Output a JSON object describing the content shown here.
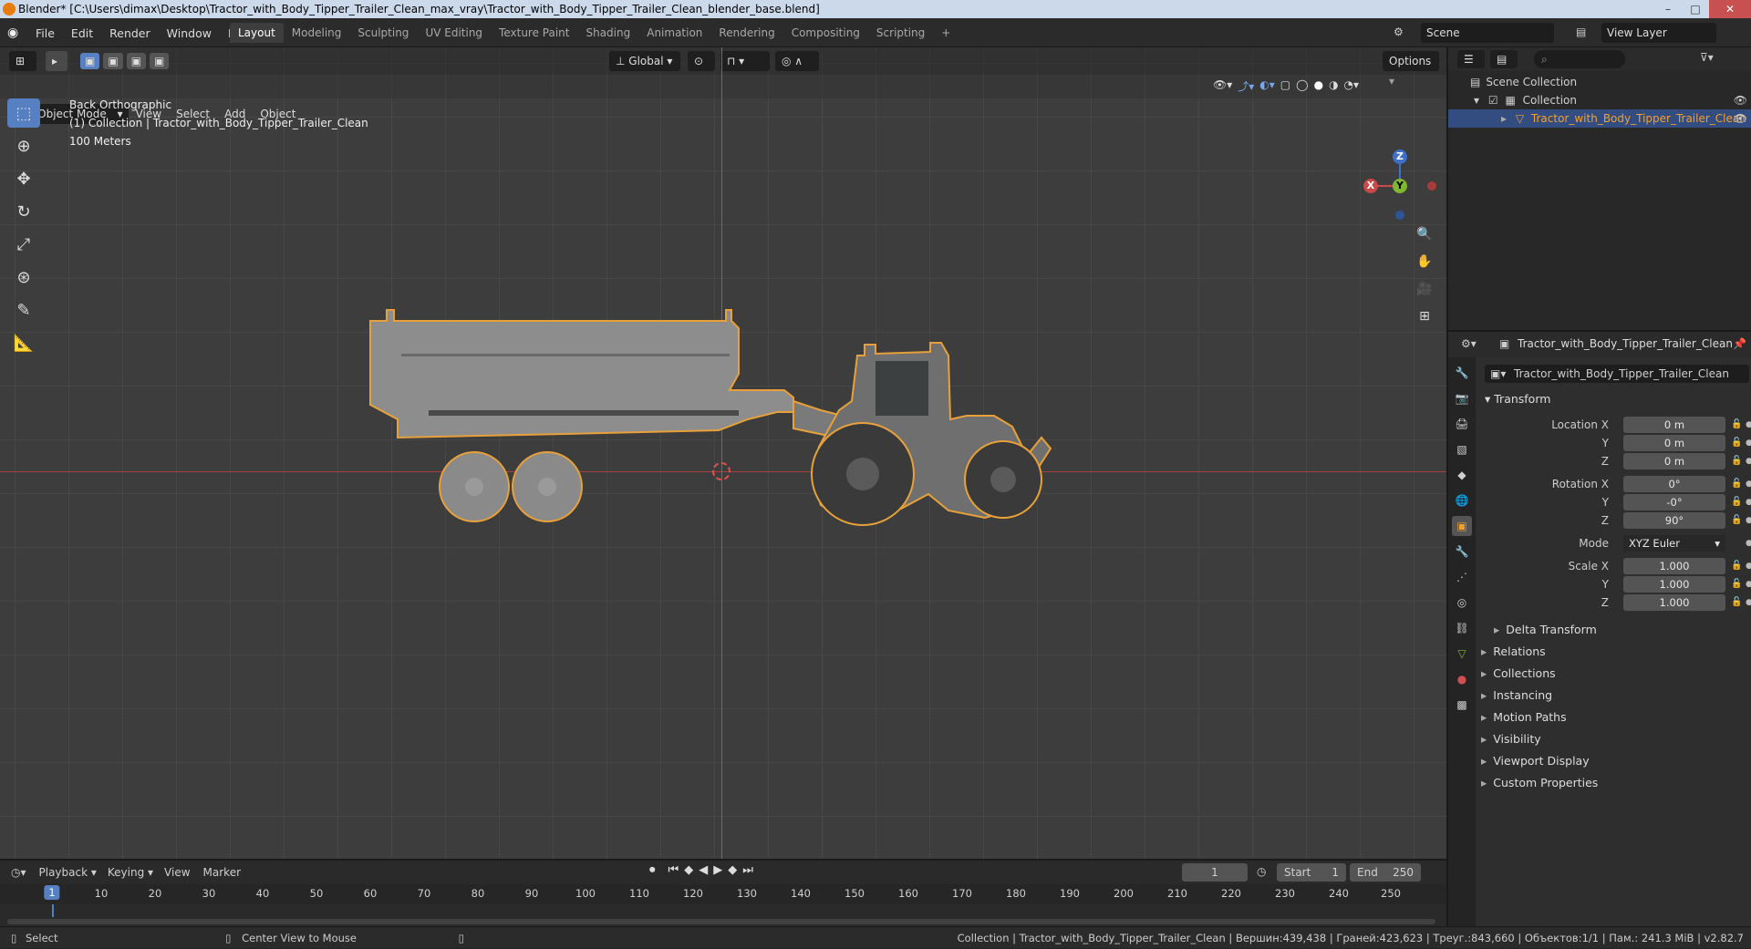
{
  "window": {
    "title": "Blender* [C:\\Users\\dimax\\Desktop\\Tractor_with_Body_Tipper_Trailer_Clean_max_vray\\Tractor_with_Body_Tipper_Trailer_Clean_blender_base.blend]"
  },
  "menu": [
    "File",
    "Edit",
    "Render",
    "Window",
    "Help"
  ],
  "workspaces": [
    "Layout",
    "Modeling",
    "Sculpting",
    "UV Editing",
    "Texture Paint",
    "Shading",
    "Animation",
    "Rendering",
    "Compositing",
    "Scripting"
  ],
  "active_workspace": "Layout",
  "scene": "Scene",
  "view_layer": "View Layer",
  "viewport": {
    "transform_orientation": "Global",
    "options_label": "Options",
    "mode": "Object Mode",
    "menus": [
      "View",
      "Select",
      "Add",
      "Object"
    ],
    "view_name": "Back Orthographic",
    "collection_info": "(1) Collection | Tractor_with_Body_Tipper_Trailer_Clean",
    "scale_info": "100 Meters",
    "gizmo": {
      "z": "Z",
      "y": "Y",
      "x": "X"
    }
  },
  "outliner": {
    "scene_collection": "Scene Collection",
    "collection": "Collection",
    "object": "Tractor_with_Body_Tipper_Trailer_Clean"
  },
  "properties": {
    "header_object": "Tractor_with_Body_Tipper_Trailer_Clean",
    "object_name": "Tractor_with_Body_Tipper_Trailer_Clean",
    "transform_title": "Transform",
    "location_label": "Location X",
    "rotation_label": "Rotation X",
    "scale_label": "Scale X",
    "y_label": "Y",
    "z_label": "Z",
    "location": [
      "0 m",
      "0 m",
      "0 m"
    ],
    "rotation": [
      "0°",
      "-0°",
      "90°"
    ],
    "mode_label": "Mode",
    "mode": "XYZ Euler",
    "scale": [
      "1.000",
      "1.000",
      "1.000"
    ],
    "delta_transform": "Delta Transform",
    "panels": [
      "Relations",
      "Collections",
      "Instancing",
      "Motion Paths",
      "Visibility",
      "Viewport Display",
      "Custom Properties"
    ]
  },
  "timeline": {
    "menus": [
      "Playback",
      "Keying",
      "View",
      "Marker"
    ],
    "current_frame": "1",
    "start_label": "Start",
    "start": "1",
    "end_label": "End",
    "end": "250",
    "ruler": [
      "1",
      "10",
      "20",
      "30",
      "40",
      "50",
      "60",
      "70",
      "80",
      "90",
      "100",
      "110",
      "120",
      "130",
      "140",
      "150",
      "160",
      "170",
      "180",
      "190",
      "200",
      "210",
      "220",
      "230",
      "240",
      "250"
    ]
  },
  "status": {
    "left": "Select",
    "middle": "Center View to Mouse",
    "right": "Collection | Tractor_with_Body_Tipper_Trailer_Clean | Вершин:439,438 | Граней:423,623 | Треуг.:843,660 | Объектов:1/1 | Пам.: 241.3 MiB | v2.82.7"
  },
  "colors": {
    "accent": "#5680c2",
    "selection_outline": "#e8a13a",
    "x_axis": "#c94848",
    "z_axis": "#3e6fc9",
    "y_axis": "#7fb82e"
  },
  "icons": [
    "blender-logo",
    "select-box-icon",
    "cursor-icon",
    "move-icon",
    "rotate-icon",
    "scale-icon",
    "transform-icon",
    "annotate-icon",
    "measure-icon",
    "zoom-icon",
    "hand-icon",
    "camera-icon",
    "grid-icon",
    "eye-icon",
    "lock-icon"
  ]
}
